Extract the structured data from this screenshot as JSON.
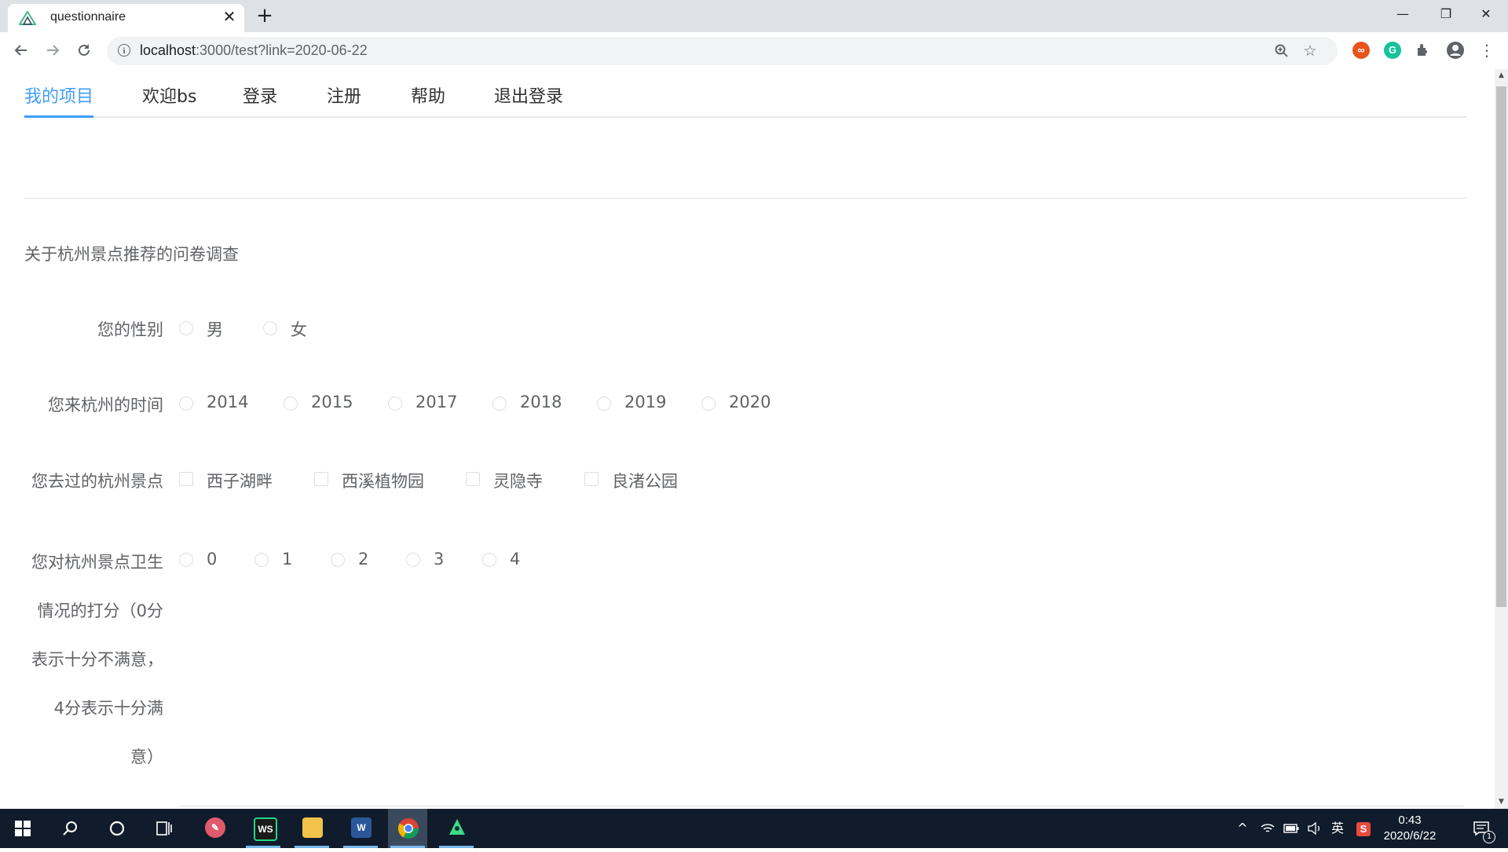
{
  "browser": {
    "tab_title": "questionnaire",
    "tab_close": "✕",
    "new_tab": "+",
    "url_host": "localhost",
    "url_rest": ":3000/test?link=2020-06-22",
    "window_controls": {
      "minimize": "—",
      "restore": "❐",
      "close": "✕"
    },
    "toolbar_icons": [
      "back-icon",
      "forward-icon",
      "reload-icon",
      "zoom-icon",
      "star-icon",
      "extensions-icon",
      "profile-icon",
      "menu-icon"
    ]
  },
  "nav": {
    "items": [
      {
        "label": "我的项目",
        "active": true
      },
      {
        "label": "欢迎bs",
        "active": false
      },
      {
        "label": "登录",
        "active": false
      },
      {
        "label": "注册",
        "active": false
      },
      {
        "label": "帮助",
        "active": false
      },
      {
        "label": "退出登录",
        "active": false
      }
    ],
    "active_color": "#409eff"
  },
  "questionnaire": {
    "title": "关于杭州景点推荐的问卷调查",
    "questions": [
      {
        "label": "您的性别",
        "type": "radio",
        "options": [
          "男",
          "女"
        ]
      },
      {
        "label": "您来杭州的时间",
        "type": "radio",
        "options": [
          "2014",
          "2015",
          "2017",
          "2018",
          "2019",
          "2020"
        ]
      },
      {
        "label": "您去过的杭州景点",
        "type": "checkbox",
        "options": [
          "西子湖畔",
          "西溪植物园",
          "灵隐寺",
          "良渚公园"
        ]
      },
      {
        "label_lines": [
          "您对杭州景点卫生",
          "情况的打分（0分",
          "表示十分不满意，",
          "4分表示十分满",
          "意）"
        ],
        "type": "radio",
        "options": [
          "0",
          "1",
          "2",
          "3",
          "4"
        ]
      }
    ]
  },
  "taskbar": {
    "apps": [
      "start-icon",
      "search-icon",
      "cortana-icon",
      "task-view-icon",
      "paint-icon",
      "webstorm-icon",
      "file-explorer-icon",
      "word-icon",
      "chrome-icon",
      "android-icon"
    ],
    "webstorm_label": "WS",
    "word_label": "W",
    "ime": "英",
    "time": "0:43",
    "date": "2020/6/22",
    "notification_count": "1"
  }
}
